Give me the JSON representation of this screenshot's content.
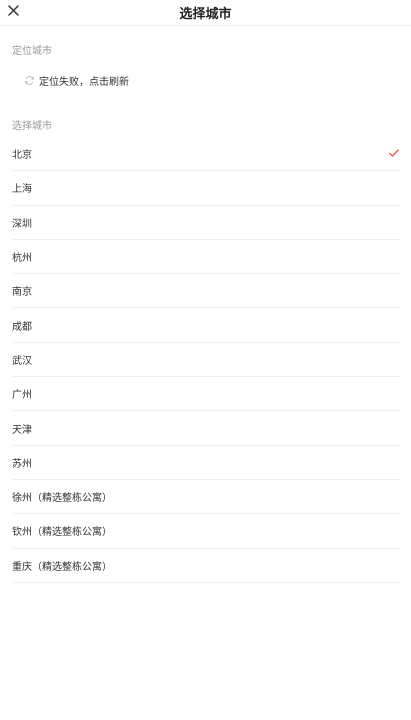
{
  "header": {
    "title": "选择城市"
  },
  "location": {
    "section_label": "定位城市",
    "status_text": "定位失败，点击刷新"
  },
  "select": {
    "section_label": "选择城市",
    "cities": [
      {
        "name": "北京",
        "selected": true
      },
      {
        "name": "上海",
        "selected": false
      },
      {
        "name": "深圳",
        "selected": false
      },
      {
        "name": "杭州",
        "selected": false
      },
      {
        "name": "南京",
        "selected": false
      },
      {
        "name": "成都",
        "selected": false
      },
      {
        "name": "武汉",
        "selected": false
      },
      {
        "name": "广州",
        "selected": false
      },
      {
        "name": "天津",
        "selected": false
      },
      {
        "name": "苏州",
        "selected": false
      },
      {
        "name": "徐州（精选整栋公寓）",
        "selected": false
      },
      {
        "name": "钦州（精选整栋公寓）",
        "selected": false
      },
      {
        "name": "重庆（精选整栋公寓）",
        "selected": false
      }
    ]
  },
  "colors": {
    "accent": "#e05a4e",
    "muted": "#999999",
    "divider": "#f0f0f0"
  }
}
